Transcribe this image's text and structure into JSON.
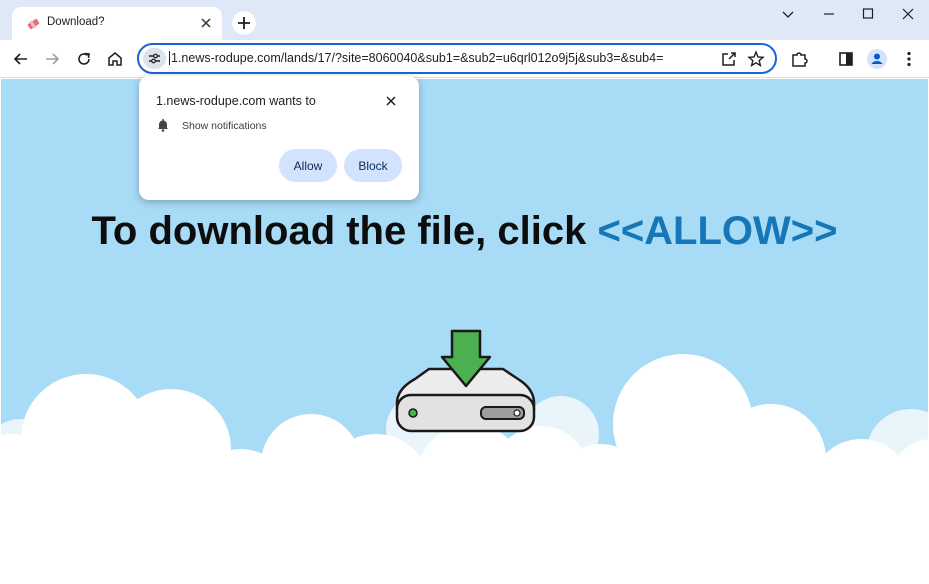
{
  "tab": {
    "title": "Download?"
  },
  "omnibox": {
    "url": "1.news-rodupe.com/lands/17/?site=8060040&sub1=&sub2=u6qrl012o9j5j&sub3=&sub4="
  },
  "popup": {
    "title": "1.news-rodupe.com wants to",
    "permission": "Show notifications",
    "allow_label": "Allow",
    "block_label": "Block"
  },
  "page": {
    "headline_main": "To download the file, click ",
    "headline_accent": "<<ALLOW>>"
  },
  "colors": {
    "tabstrip": "#dfe8f6",
    "omnibox_border": "#1a64d6",
    "sky": "#a8dbf6",
    "accent": "#1577b8",
    "button_bg": "#d3e3fd",
    "arrow": "#4caf50"
  },
  "icons": {
    "favicon": "tab-favicon-icon",
    "site_info": "tune-icon",
    "share": "share-icon",
    "bookmark": "star-icon",
    "extensions": "puzzle-icon",
    "side_panel": "side-panel-icon",
    "profile": "profile-icon",
    "menu": "kebab-menu-icon",
    "notification": "bell-icon",
    "download": "download-drive-icon"
  }
}
